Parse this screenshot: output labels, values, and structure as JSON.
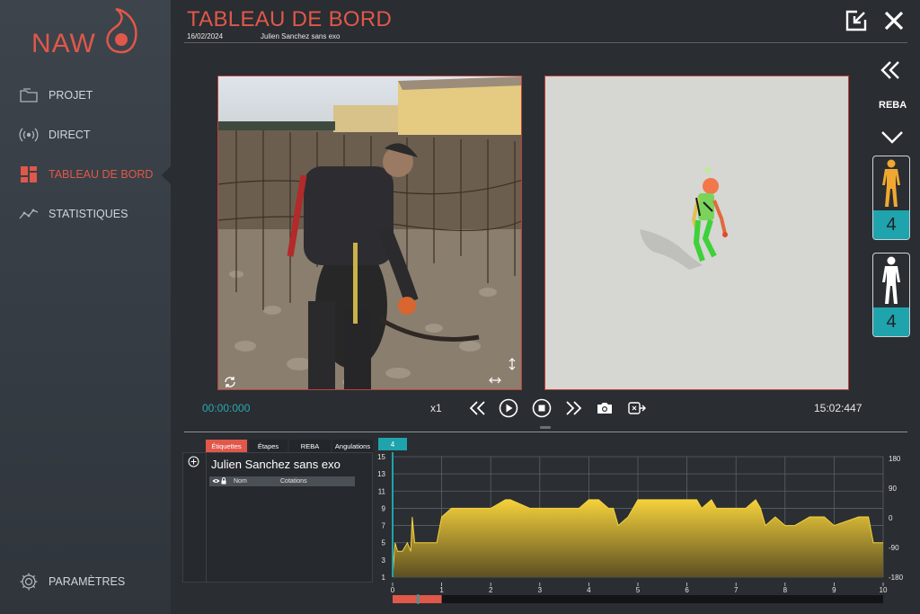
{
  "app": {
    "logo_text": "NAW",
    "brand_color": "#e0584a",
    "accent_color": "#1fa3ad"
  },
  "sidebar": {
    "items": [
      {
        "label": "PROJET",
        "icon": "folder-icon"
      },
      {
        "label": "DIRECT",
        "icon": "broadcast-icon"
      },
      {
        "label": "TABLEAU DE BORD",
        "icon": "dashboard-icon",
        "active": true
      },
      {
        "label": "STATISTIQUES",
        "icon": "line-chart-icon"
      }
    ],
    "settings_label": "PARAMÈTRES"
  },
  "header": {
    "title": "TABLEAU DE BORD",
    "date": "16/02/2024",
    "session_name": "Julien Sanchez sans exo"
  },
  "player": {
    "current_time": "00:00:000",
    "speed": "x1",
    "end_time": "15:02:447"
  },
  "right_panel": {
    "method_label": "REBA",
    "scores": [
      {
        "value": "4",
        "figure_color": "#f0a830",
        "icon": "body-orange-icon"
      },
      {
        "value": "4",
        "figure_color": "#ffffff",
        "icon": "body-white-icon"
      }
    ]
  },
  "tabs": [
    {
      "label": "Étiquettes",
      "active": true
    },
    {
      "label": "Étapes"
    },
    {
      "label": "REBA"
    },
    {
      "label": "Angulations"
    }
  ],
  "cursor_badge": "4",
  "labels_panel": {
    "title": "Julien Sanchez sans exo",
    "columns": [
      "Nom",
      "Cotations"
    ]
  },
  "chart_data": {
    "type": "area",
    "x": [
      0,
      0.05,
      0.1,
      0.2,
      0.3,
      0.37,
      0.4,
      0.45,
      0.55,
      0.6,
      0.7,
      0.8,
      0.9,
      1.0,
      1.2,
      1.5,
      2.0,
      2.3,
      2.4,
      2.8,
      2.9,
      3.2,
      3.5,
      3.8,
      4.0,
      4.2,
      4.4,
      4.5,
      4.6,
      4.8,
      5.0,
      5.5,
      6.0,
      6.2,
      6.3,
      6.5,
      6.6,
      7.0,
      7.2,
      7.4,
      7.5,
      7.6,
      7.8,
      8.0,
      8.2,
      8.5,
      8.8,
      9.0,
      9.5,
      9.7,
      9.8,
      10.0
    ],
    "values": [
      1,
      5,
      4,
      4,
      5,
      4,
      8,
      5,
      5,
      5,
      5,
      5,
      5,
      8,
      9,
      9,
      9,
      10,
      10,
      9,
      9,
      9,
      9,
      9,
      10,
      10,
      9,
      9,
      7,
      8,
      10,
      10,
      10,
      10,
      9,
      10,
      9,
      9,
      9,
      10,
      9,
      7,
      8,
      7,
      7,
      8,
      8,
      7,
      8,
      8,
      5,
      5
    ],
    "title": "",
    "xlabel": "",
    "ylabel": "",
    "ylim": [
      1,
      15
    ],
    "yticks": [
      1,
      3,
      5,
      7,
      9,
      11,
      13,
      15
    ],
    "y2ticks": [
      180,
      90,
      0,
      -90,
      -180
    ],
    "xlim": [
      0,
      10
    ],
    "xticks": [
      0,
      1,
      2,
      3,
      4,
      5,
      6,
      7,
      8,
      9,
      10
    ],
    "grid": true,
    "fill_color": "#f5d13b",
    "cursor_x": 0
  },
  "timeline": {
    "playhead_fraction": 0.05
  }
}
